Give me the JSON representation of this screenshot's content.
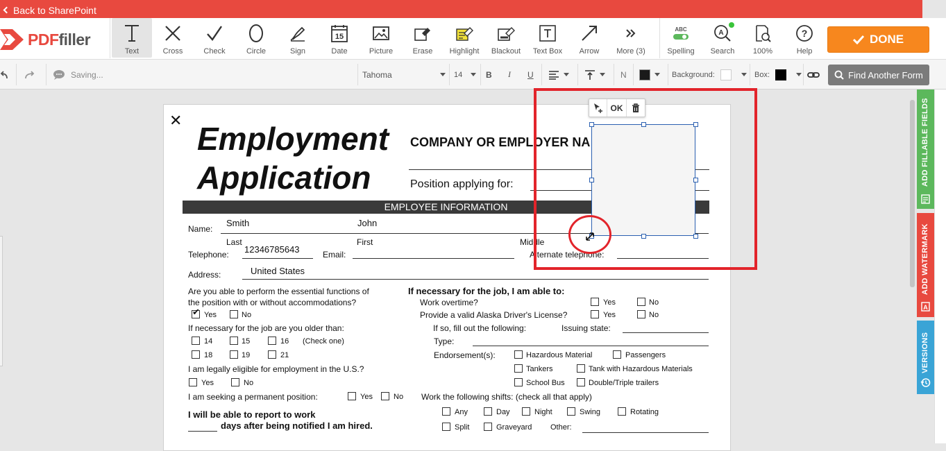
{
  "topbar": {
    "back_label": "Back to SharePoint"
  },
  "logo": {
    "brand_pdf": "PDF",
    "brand_filler": "filler"
  },
  "tools": [
    {
      "label": "Text",
      "icon": "text-icon"
    },
    {
      "label": "Cross",
      "icon": "cross-icon"
    },
    {
      "label": "Check",
      "icon": "check-icon"
    },
    {
      "label": "Circle",
      "icon": "circle-icon"
    },
    {
      "label": "Sign",
      "icon": "sign-icon"
    },
    {
      "label": "Date",
      "icon": "date-icon"
    },
    {
      "label": "Picture",
      "icon": "picture-icon"
    },
    {
      "label": "Erase",
      "icon": "erase-icon"
    },
    {
      "label": "Highlight",
      "icon": "highlight-icon"
    },
    {
      "label": "Blackout",
      "icon": "blackout-icon"
    },
    {
      "label": "Text Box",
      "icon": "text-box-icon"
    },
    {
      "label": "Arrow",
      "icon": "arrow-icon"
    },
    {
      "label": "More (3)",
      "icon": "more-icon"
    }
  ],
  "right_tools": [
    {
      "label": "Spelling",
      "icon": "spelling-icon",
      "abc": "ABC"
    },
    {
      "label": "Search",
      "icon": "search-icon"
    },
    {
      "label": "100%",
      "icon": "zoom-icon"
    },
    {
      "label": "Help",
      "icon": "help-icon"
    }
  ],
  "done_label": "DONE",
  "format": {
    "status": "Saving...",
    "font": "Tahoma",
    "size": "14",
    "bold": "B",
    "italic": "I",
    "underline": "U",
    "n_label": "N",
    "background_label": "Background:",
    "box_label": "Box:",
    "find_form": "Find Another Form"
  },
  "side_tabs": {
    "fillable": "ADD FILLABLE FIELDS",
    "watermark": "ADD WATERMARK",
    "versions": "VERSIONS"
  },
  "colors": {
    "accent": "#e8493f",
    "done": "#f7871e",
    "tab_green": "#5cb85c",
    "tab_red": "#e8493f",
    "tab_blue": "#3aa4d6",
    "select_red": "#e2242b"
  },
  "field_toolbar": {
    "ok": "OK"
  },
  "form": {
    "title_line1": "Employment",
    "title_line2": "Application",
    "company_label": "COMPANY OR EMPLOYER NA",
    "position_label": "Position applying for:",
    "section_header": "EMPLOYEE INFORMATION",
    "name_label": "Name:",
    "last_value": "Smith",
    "first_value": "John",
    "last_label": "Last",
    "first_label": "First",
    "middle_label": "Middle",
    "telephone_label": "Telephone:",
    "telephone_value": "12346785643",
    "email_label": "Email:",
    "alt_phone_label": "Alternate telephone:",
    "address_label": "Address:",
    "address_value": "United States",
    "q_functions_1": "Are you able to perform the essential functions of",
    "q_functions_2": "the position with or without accommodations?",
    "yes": "Yes",
    "no": "No",
    "q_older": "If necessary for the job are you older than:",
    "age_14": "14",
    "age_15": "15",
    "age_16": "16",
    "check_one": "(Check one)",
    "age_18": "18",
    "age_19": "19",
    "age_21": "21",
    "q_eligible": "I am legally eligible for employment in the U.S.?",
    "q_permanent": "I am seeking a permanent position:",
    "report_1": "I will be able to report to work",
    "report_2": "days after being notified I am hired.",
    "job_able": "If necessary for the job, I am able to:",
    "overtime": "Work overtime?",
    "license": "Provide a valid Alaska Driver's License?",
    "if_so": "If so, fill out the following:",
    "issuing_state": "Issuing state:",
    "type_label": "Type:",
    "endorsements": "Endorsement(s):",
    "hazmat": "Hazardous Material",
    "passengers": "Passengers",
    "tankers": "Tankers",
    "tank_hazmat": "Tank with Hazardous Materials",
    "school_bus": "School Bus",
    "double_triple": "Double/Triple trailers",
    "shifts_label": "Work the following shifts: (check all that apply)",
    "any": "Any",
    "day": "Day",
    "night": "Night",
    "swing": "Swing",
    "rotating": "Rotating",
    "split": "Split",
    "graveyard": "Graveyard",
    "other": "Other:"
  }
}
